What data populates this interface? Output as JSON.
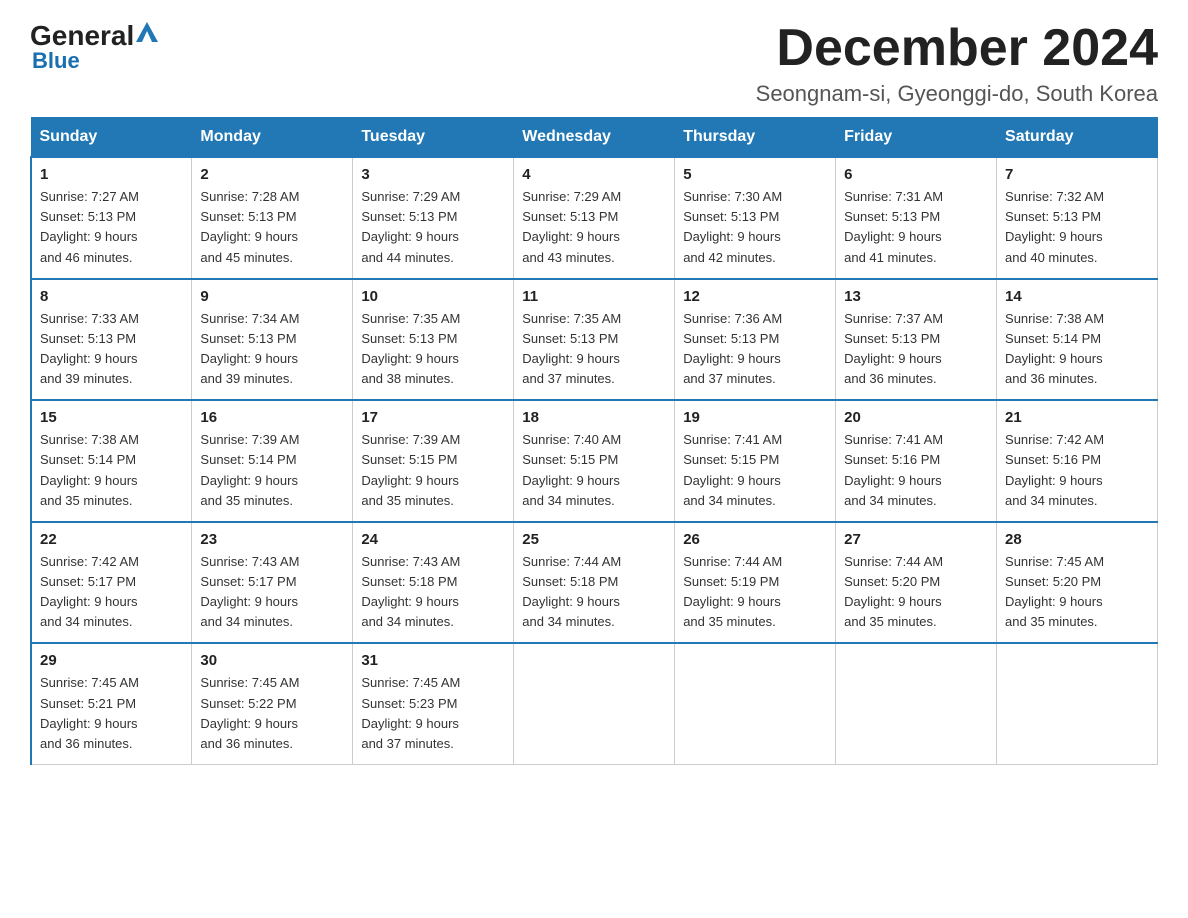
{
  "logo": {
    "general": "General",
    "triangle": "▲",
    "blue": "Blue"
  },
  "title": "December 2024",
  "location": "Seongnam-si, Gyeonggi-do, South Korea",
  "weekdays": [
    "Sunday",
    "Monday",
    "Tuesday",
    "Wednesday",
    "Thursday",
    "Friday",
    "Saturday"
  ],
  "weeks": [
    [
      {
        "day": "1",
        "sunrise": "7:27 AM",
        "sunset": "5:13 PM",
        "daylight": "9 hours and 46 minutes."
      },
      {
        "day": "2",
        "sunrise": "7:28 AM",
        "sunset": "5:13 PM",
        "daylight": "9 hours and 45 minutes."
      },
      {
        "day": "3",
        "sunrise": "7:29 AM",
        "sunset": "5:13 PM",
        "daylight": "9 hours and 44 minutes."
      },
      {
        "day": "4",
        "sunrise": "7:29 AM",
        "sunset": "5:13 PM",
        "daylight": "9 hours and 43 minutes."
      },
      {
        "day": "5",
        "sunrise": "7:30 AM",
        "sunset": "5:13 PM",
        "daylight": "9 hours and 42 minutes."
      },
      {
        "day": "6",
        "sunrise": "7:31 AM",
        "sunset": "5:13 PM",
        "daylight": "9 hours and 41 minutes."
      },
      {
        "day": "7",
        "sunrise": "7:32 AM",
        "sunset": "5:13 PM",
        "daylight": "9 hours and 40 minutes."
      }
    ],
    [
      {
        "day": "8",
        "sunrise": "7:33 AM",
        "sunset": "5:13 PM",
        "daylight": "9 hours and 39 minutes."
      },
      {
        "day": "9",
        "sunrise": "7:34 AM",
        "sunset": "5:13 PM",
        "daylight": "9 hours and 39 minutes."
      },
      {
        "day": "10",
        "sunrise": "7:35 AM",
        "sunset": "5:13 PM",
        "daylight": "9 hours and 38 minutes."
      },
      {
        "day": "11",
        "sunrise": "7:35 AM",
        "sunset": "5:13 PM",
        "daylight": "9 hours and 37 minutes."
      },
      {
        "day": "12",
        "sunrise": "7:36 AM",
        "sunset": "5:13 PM",
        "daylight": "9 hours and 37 minutes."
      },
      {
        "day": "13",
        "sunrise": "7:37 AM",
        "sunset": "5:13 PM",
        "daylight": "9 hours and 36 minutes."
      },
      {
        "day": "14",
        "sunrise": "7:38 AM",
        "sunset": "5:14 PM",
        "daylight": "9 hours and 36 minutes."
      }
    ],
    [
      {
        "day": "15",
        "sunrise": "7:38 AM",
        "sunset": "5:14 PM",
        "daylight": "9 hours and 35 minutes."
      },
      {
        "day": "16",
        "sunrise": "7:39 AM",
        "sunset": "5:14 PM",
        "daylight": "9 hours and 35 minutes."
      },
      {
        "day": "17",
        "sunrise": "7:39 AM",
        "sunset": "5:15 PM",
        "daylight": "9 hours and 35 minutes."
      },
      {
        "day": "18",
        "sunrise": "7:40 AM",
        "sunset": "5:15 PM",
        "daylight": "9 hours and 34 minutes."
      },
      {
        "day": "19",
        "sunrise": "7:41 AM",
        "sunset": "5:15 PM",
        "daylight": "9 hours and 34 minutes."
      },
      {
        "day": "20",
        "sunrise": "7:41 AM",
        "sunset": "5:16 PM",
        "daylight": "9 hours and 34 minutes."
      },
      {
        "day": "21",
        "sunrise": "7:42 AM",
        "sunset": "5:16 PM",
        "daylight": "9 hours and 34 minutes."
      }
    ],
    [
      {
        "day": "22",
        "sunrise": "7:42 AM",
        "sunset": "5:17 PM",
        "daylight": "9 hours and 34 minutes."
      },
      {
        "day": "23",
        "sunrise": "7:43 AM",
        "sunset": "5:17 PM",
        "daylight": "9 hours and 34 minutes."
      },
      {
        "day": "24",
        "sunrise": "7:43 AM",
        "sunset": "5:18 PM",
        "daylight": "9 hours and 34 minutes."
      },
      {
        "day": "25",
        "sunrise": "7:44 AM",
        "sunset": "5:18 PM",
        "daylight": "9 hours and 34 minutes."
      },
      {
        "day": "26",
        "sunrise": "7:44 AM",
        "sunset": "5:19 PM",
        "daylight": "9 hours and 35 minutes."
      },
      {
        "day": "27",
        "sunrise": "7:44 AM",
        "sunset": "5:20 PM",
        "daylight": "9 hours and 35 minutes."
      },
      {
        "day": "28",
        "sunrise": "7:45 AM",
        "sunset": "5:20 PM",
        "daylight": "9 hours and 35 minutes."
      }
    ],
    [
      {
        "day": "29",
        "sunrise": "7:45 AM",
        "sunset": "5:21 PM",
        "daylight": "9 hours and 36 minutes."
      },
      {
        "day": "30",
        "sunrise": "7:45 AM",
        "sunset": "5:22 PM",
        "daylight": "9 hours and 36 minutes."
      },
      {
        "day": "31",
        "sunrise": "7:45 AM",
        "sunset": "5:23 PM",
        "daylight": "9 hours and 37 minutes."
      },
      null,
      null,
      null,
      null
    ]
  ],
  "labels": {
    "sunrise": "Sunrise:",
    "sunset": "Sunset:",
    "daylight": "Daylight:"
  }
}
